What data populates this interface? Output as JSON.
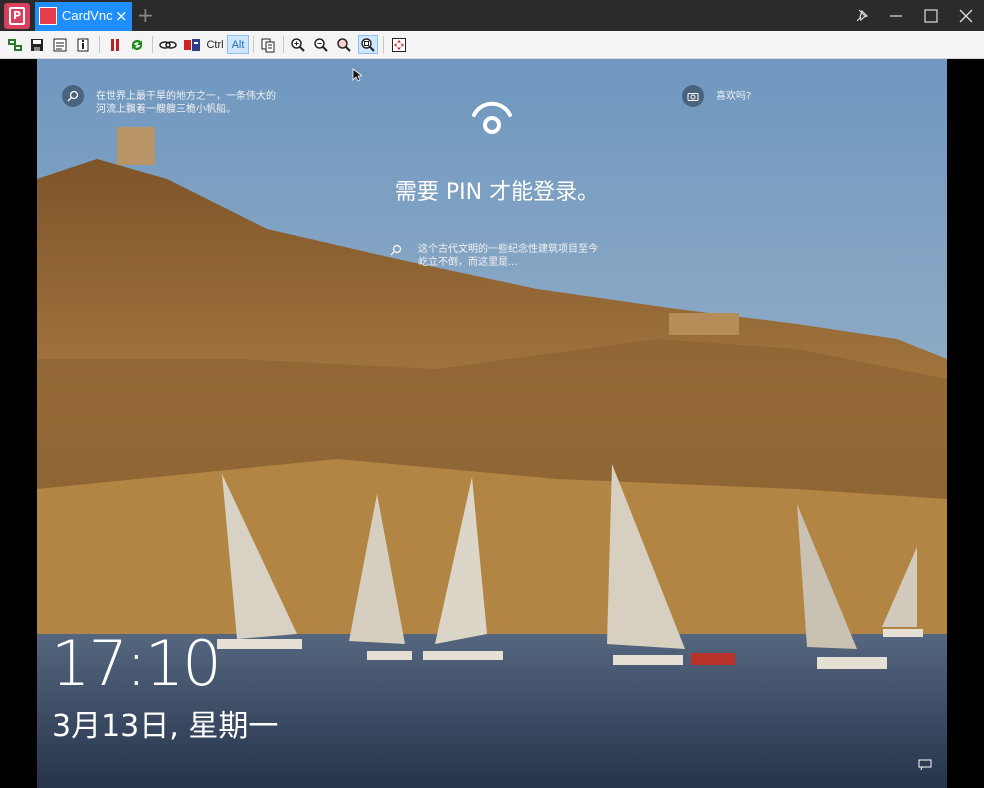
{
  "window": {
    "tab_label": "CardVnc",
    "tab_close": "×",
    "new_tab": "+"
  },
  "toolbar": {
    "ctrl_label": "Ctrl",
    "alt_label": "Alt"
  },
  "lockscreen": {
    "top_left_hint": "在世界上最干旱的地方之一，一条伟大的河流上飘着一艘艘三桅小帆船。",
    "top_left_hint_line1": "在世界上最干旱的地方之一，一条伟大的",
    "top_left_hint_line2": "河流上飘着一艘艘三桅小帆船。",
    "top_right_hint": "喜欢吗?",
    "pin_prompt": "需要 PIN 才能登录。",
    "center_hint_line1": "这个古代文明的一些纪念性建筑项目至今",
    "center_hint_line2": "屹立不倒，而这里是...",
    "time": "17:10",
    "date": "3月13日, 星期一"
  },
  "colors": {
    "titlebar_bg": "#2b2b2b",
    "tab_accent": "#1f8fff",
    "app_brand": "#d9405c"
  }
}
